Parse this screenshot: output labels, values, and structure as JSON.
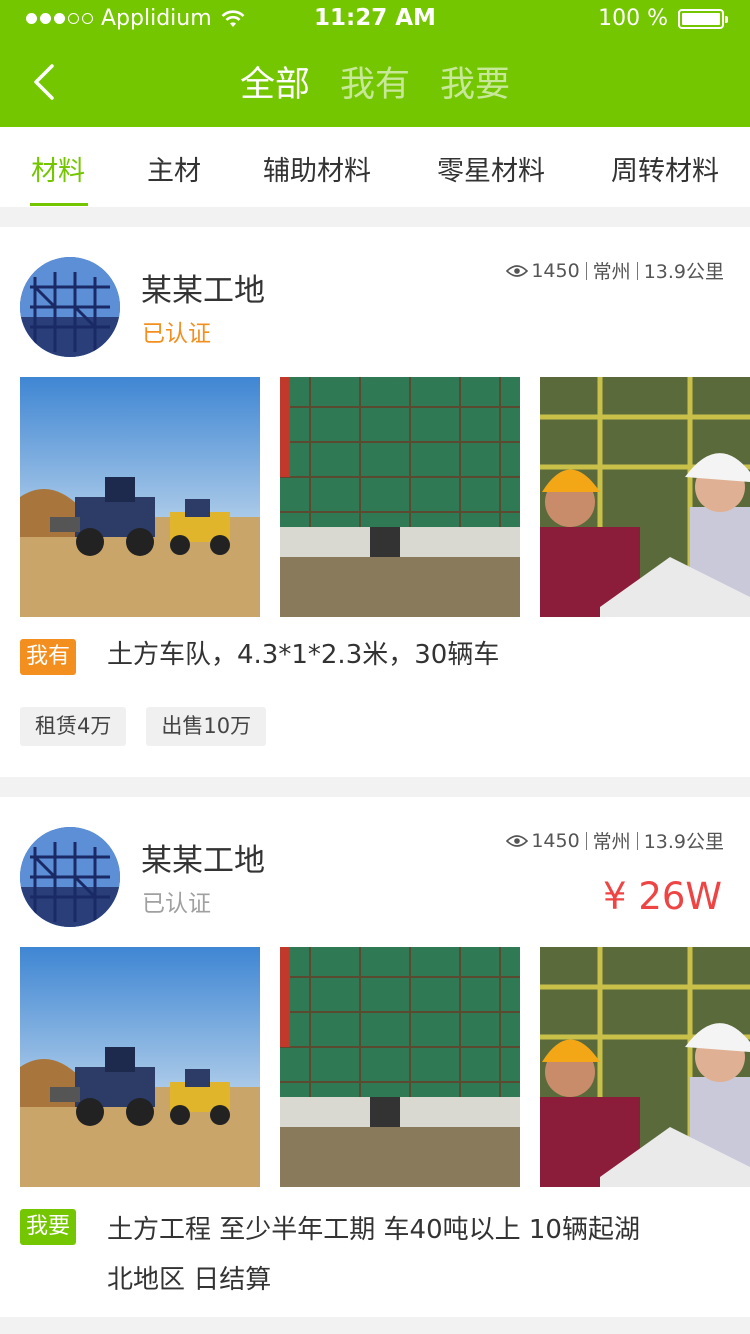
{
  "status": {
    "carrier": "Applidium",
    "time": "11:27 AM",
    "battery": "100 %"
  },
  "nav": {
    "tabs": [
      {
        "label": "全部"
      },
      {
        "label": "我有"
      },
      {
        "label": "我要"
      }
    ]
  },
  "categories": [
    {
      "label": "材料"
    },
    {
      "label": "主材"
    },
    {
      "label": "辅助材料"
    },
    {
      "label": "零星材料"
    },
    {
      "label": "周转材料"
    }
  ],
  "posts": [
    {
      "name": "某某工地",
      "verified": "已认证",
      "views": "1450",
      "city": "常州",
      "distance": "13.9公里",
      "tag": "我有",
      "desc": "土方车队，4.3*1*2.3米，30辆车",
      "chips": [
        {
          "label": "租赁4万"
        },
        {
          "label": "出售10万"
        }
      ]
    },
    {
      "name": "某某工地",
      "verified": "已认证",
      "views": "1450",
      "city": "常州",
      "distance": "13.9公里",
      "price": "¥ 26W",
      "tag": "我要",
      "desc_line1": "土方工程 至少半年工期 车40吨以上 10辆起湖",
      "desc_line2": "北地区 日结算"
    }
  ],
  "colors": {
    "brand": "#74c600",
    "orange": "#f38f1f",
    "price": "#ef4444"
  }
}
